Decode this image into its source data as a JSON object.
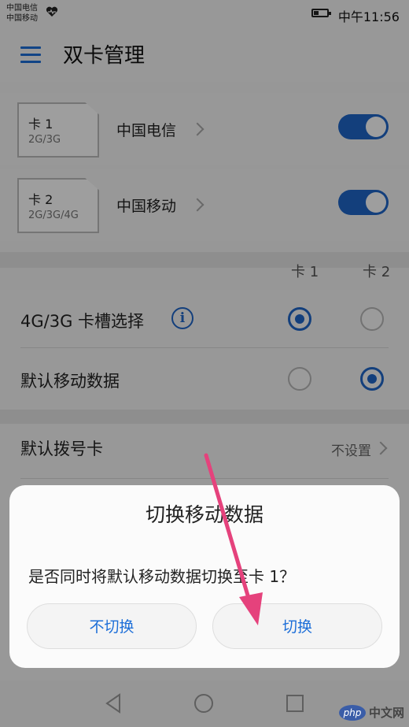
{
  "status_bar": {
    "carrier_1": "中国电信",
    "carrier_2": "中国移动",
    "time": "中午11:56"
  },
  "header": {
    "title": "双卡管理"
  },
  "sim_cards": [
    {
      "name": "卡 1",
      "network": "2G/3G",
      "carrier": "中国电信",
      "enabled": true
    },
    {
      "name": "卡 2",
      "network": "2G/3G/4G",
      "carrier": "中国移动",
      "enabled": true
    }
  ],
  "columns": {
    "card1": "卡 1",
    "card2": "卡 2"
  },
  "settings": {
    "slot_select": {
      "label": "4G/3G 卡槽选择",
      "info_icon": "i",
      "selected": "card1"
    },
    "default_data": {
      "label": "默认移动数据",
      "selected": "card2"
    },
    "default_dial": {
      "label": "默认拨号卡",
      "value": "不设置"
    }
  },
  "dialog": {
    "title": "切换移动数据",
    "message": "是否同时将默认移动数据切换至卡 1？",
    "cancel_label": "不切换",
    "confirm_label": "切换"
  },
  "watermark": {
    "logo": "php",
    "text": "中文网"
  },
  "colors": {
    "accent": "#1f66c9",
    "annotation_arrow": "#e5427c"
  }
}
